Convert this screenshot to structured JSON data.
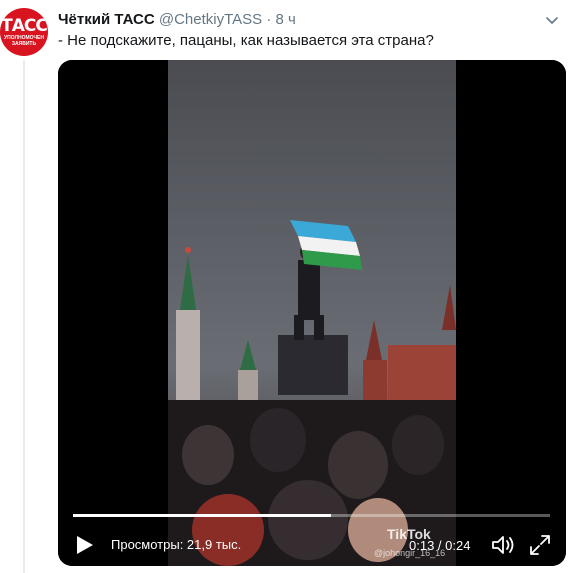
{
  "account": {
    "display_name": "Чёткий ТАСС",
    "handle": "@ChetkiyTASS",
    "separator": "·",
    "time": "8 ч",
    "avatar_logo_main": "ТАСС",
    "avatar_logo_sub": "УПОЛНОМОЧЕН ЗАЯВИТЬ"
  },
  "tweet": {
    "text": "- Не подскажите, пацаны, как называется эта страна?"
  },
  "video": {
    "views_label": "Просмотры: 21,9 тыс.",
    "current_time": "0:13",
    "duration": "0:24",
    "time_separator": " / ",
    "progress": 0.54,
    "watermark": "TikTok",
    "watermark_user": "@johongir_16_16"
  },
  "colors": {
    "brand_red": "#d7141f",
    "text_primary": "#14171a",
    "text_secondary": "#657786"
  }
}
